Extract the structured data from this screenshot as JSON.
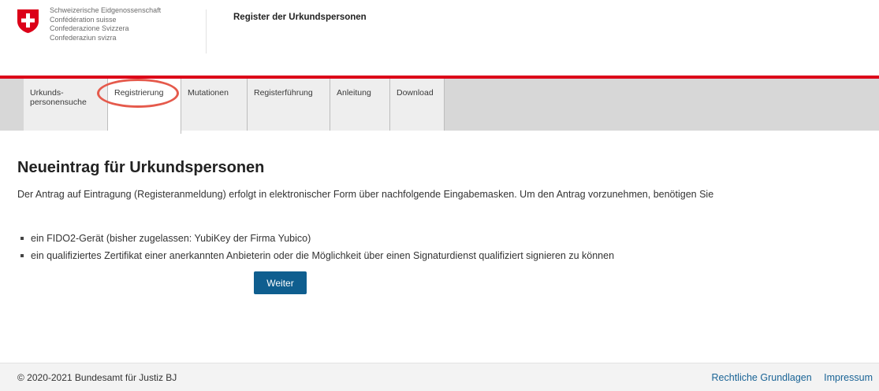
{
  "header": {
    "confederation_lines": [
      "Schweizerische Eidgenossenschaft",
      "Confédération suisse",
      "Confederazione Svizzera",
      "Confederaziun svizra"
    ],
    "app_title": "Register der Urkundspersonen",
    "logo_icon": "swiss-cross-shield-icon",
    "colors": {
      "brand_red": "#dc0018"
    }
  },
  "nav": {
    "tabs": [
      {
        "label": "Urkunds-personensuche",
        "active": false
      },
      {
        "label": "Registrierung",
        "active": true
      },
      {
        "label": "Mutationen",
        "active": false
      },
      {
        "label": "Registerführung",
        "active": false
      },
      {
        "label": "Anleitung",
        "active": false
      },
      {
        "label": "Download",
        "active": false
      }
    ]
  },
  "main": {
    "title": "Neueintrag für Urkundspersonen",
    "intro": "Der Antrag auf Eintragung (Registeranmeldung) erfolgt in elektronischer Form über nachfolgende Eingabemasken. Um den Antrag vorzunehmen, benötigen Sie",
    "requirements": [
      "ein FIDO2-Gerät (bisher zugelassen: YubiKey der Firma Yubico)",
      "ein qualifiziertes Zertifikat einer anerkannten Anbieterin oder die Möglichkeit über einen Signaturdienst qualifiziert signieren zu können"
    ],
    "next_button": "Weiter",
    "colors": {
      "button": "#0f5e8f"
    }
  },
  "footer": {
    "copyright": "© 2020-2021 Bundesamt für Justiz BJ",
    "links": [
      "Rechtliche Grundlagen",
      "Impressum"
    ],
    "colors": {
      "link": "#1a6496"
    }
  }
}
